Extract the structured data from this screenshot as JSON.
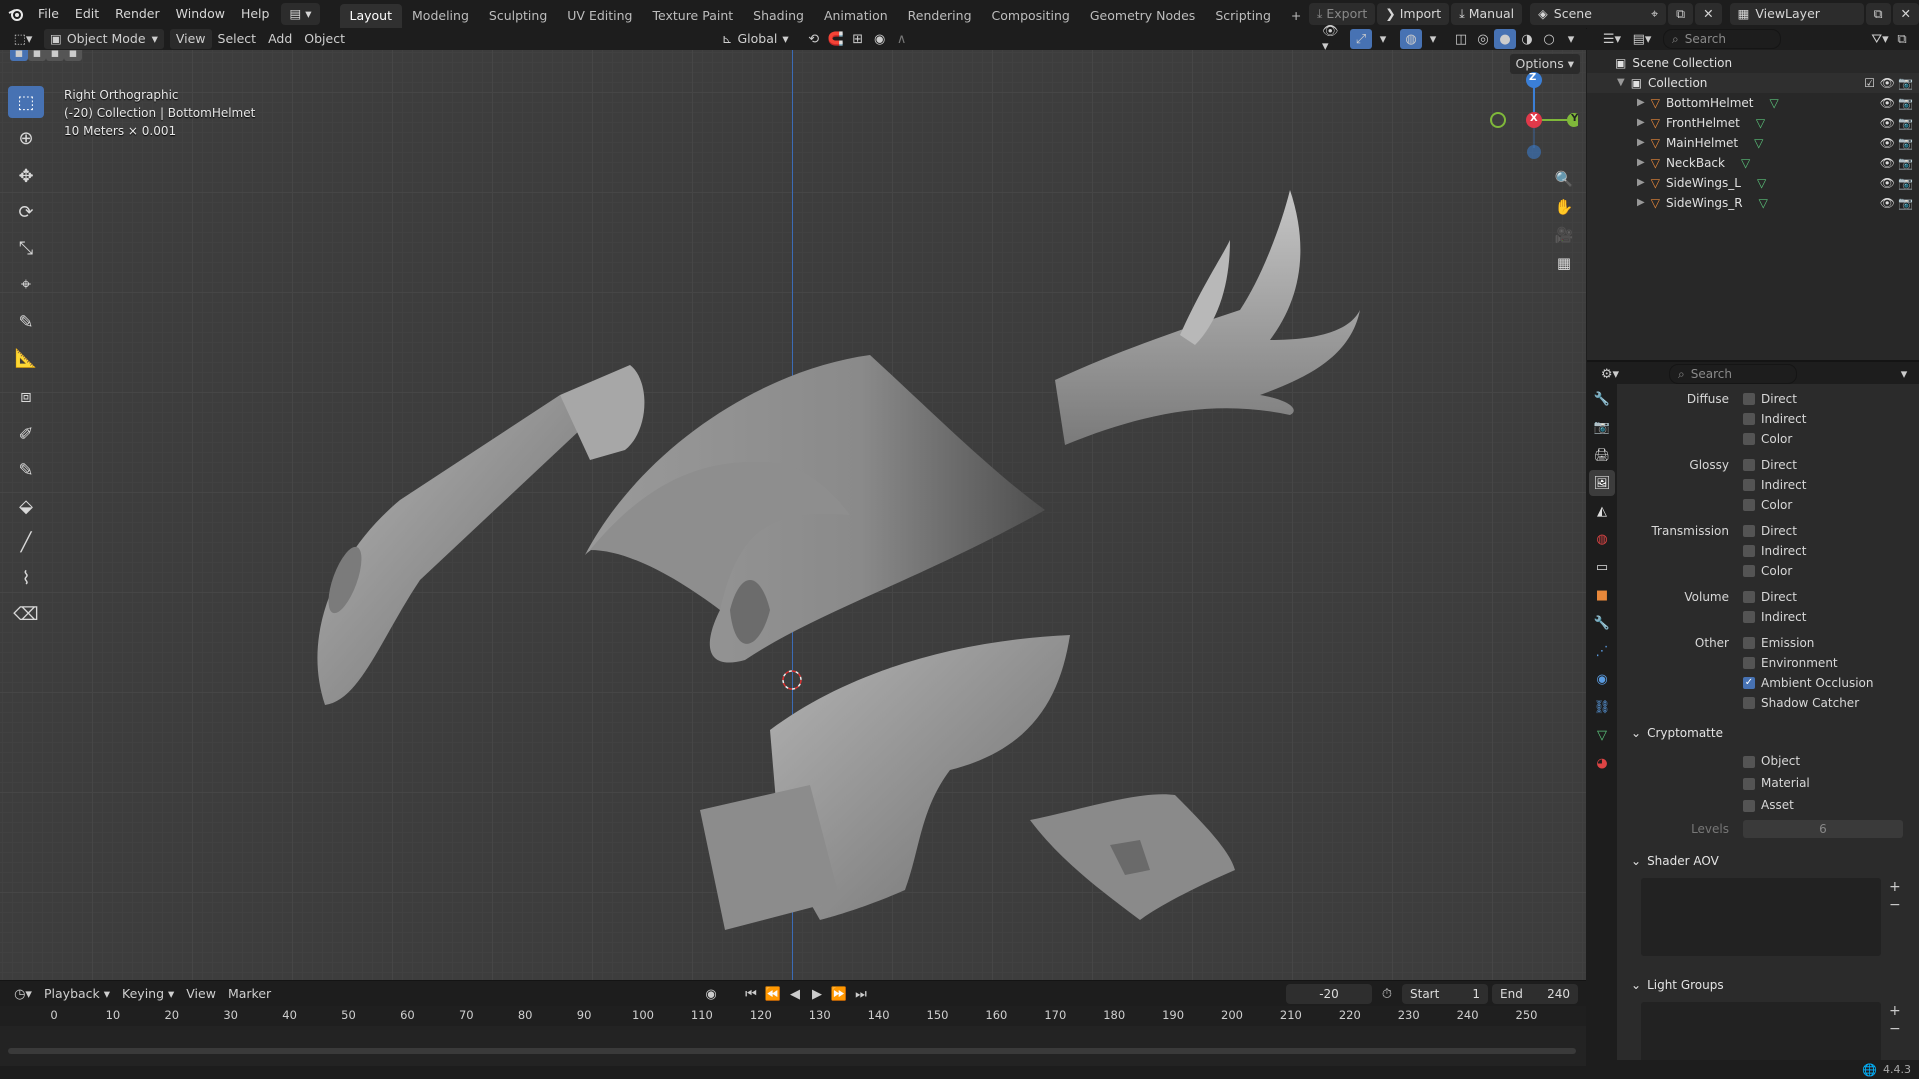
{
  "menubar": {
    "items": [
      "File",
      "Edit",
      "Render",
      "Window",
      "Help"
    ]
  },
  "workspaces": [
    "Layout",
    "Modeling",
    "Sculpting",
    "UV Editing",
    "Texture Paint",
    "Shading",
    "Animation",
    "Rendering",
    "Compositing",
    "Geometry Nodes",
    "Scripting"
  ],
  "top_right": {
    "export": "Export",
    "import": "Import",
    "manual": "Manual",
    "scene": "Scene",
    "view_layer": "ViewLayer"
  },
  "viewport_header": {
    "mode": "Object Mode",
    "view": "View",
    "select": "Select",
    "add": "Add",
    "object": "Object",
    "orientation": "Global",
    "options": "Options"
  },
  "viewport_info": {
    "line1": "Right Orthographic",
    "line2": "(-20) Collection | BottomHelmet",
    "line3": "10 Meters × 0.001"
  },
  "gizmo": {
    "z": "Z",
    "x": "X",
    "y": "Y"
  },
  "outliner": {
    "search_placeholder": "Search",
    "scene_collection": "Scene Collection",
    "collection": "Collection",
    "objects": [
      "BottomHelmet",
      "FrontHelmet",
      "MainHelmet",
      "NeckBack",
      "SideWings_L",
      "SideWings_R"
    ]
  },
  "properties": {
    "search_placeholder": "Search",
    "passes": [
      {
        "label": "Diffuse",
        "items": [
          {
            "name": "Direct",
            "checked": false
          },
          {
            "name": "Indirect",
            "checked": false
          },
          {
            "name": "Color",
            "checked": false
          }
        ]
      },
      {
        "label": "Glossy",
        "items": [
          {
            "name": "Direct",
            "checked": false
          },
          {
            "name": "Indirect",
            "checked": false
          },
          {
            "name": "Color",
            "checked": false
          }
        ]
      },
      {
        "label": "Transmission",
        "items": [
          {
            "name": "Direct",
            "checked": false
          },
          {
            "name": "Indirect",
            "checked": false
          },
          {
            "name": "Color",
            "checked": false
          }
        ]
      },
      {
        "label": "Volume",
        "items": [
          {
            "name": "Direct",
            "checked": false
          },
          {
            "name": "Indirect",
            "checked": false
          }
        ]
      },
      {
        "label": "Other",
        "items": [
          {
            "name": "Emission",
            "checked": false
          },
          {
            "name": "Environment",
            "checked": false
          },
          {
            "name": "Ambient Occlusion",
            "checked": true
          },
          {
            "name": "Shadow Catcher",
            "checked": false
          }
        ]
      }
    ],
    "cryptomatte": {
      "title": "Cryptomatte",
      "items": [
        {
          "name": "Object",
          "checked": false
        },
        {
          "name": "Material",
          "checked": false
        },
        {
          "name": "Asset",
          "checked": false
        }
      ],
      "levels_label": "Levels",
      "levels_value": "6"
    },
    "shader_aov": "Shader AOV",
    "light_groups": "Light Groups"
  },
  "timeline": {
    "playback": "Playback",
    "keying": "Keying",
    "view": "View",
    "marker": "Marker",
    "current_frame": "-20",
    "start_label": "Start",
    "start_value": "1",
    "end_label": "End",
    "end_value": "240",
    "ticks": [
      "0",
      "10",
      "20",
      "30",
      "40",
      "50",
      "60",
      "70",
      "80",
      "90",
      "100",
      "110",
      "120",
      "130",
      "140",
      "150",
      "160",
      "170",
      "180",
      "190",
      "200",
      "210",
      "220",
      "230",
      "240",
      "250"
    ]
  },
  "status": {
    "version": "4.4.3"
  },
  "colors": {
    "accent": "#4772b3",
    "axis_x": "#e0394a",
    "axis_y": "#7fb83a",
    "axis_z": "#3b7fd6",
    "mesh_orange": "#e8883a",
    "mesh_data_green": "#5bc27a"
  }
}
